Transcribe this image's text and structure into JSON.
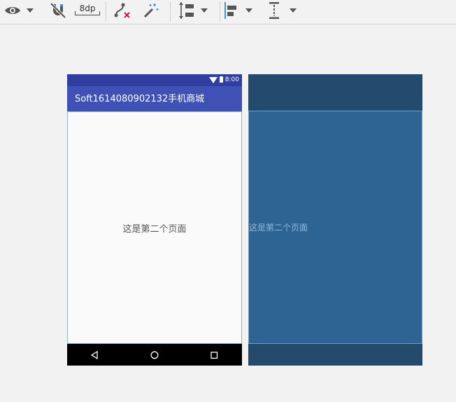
{
  "toolbar": {
    "items": [
      {
        "name": "view-options",
        "icon": "eye-icon"
      },
      {
        "name": "autoconnect",
        "icon": "magnet-off-icon"
      },
      {
        "name": "default-margin",
        "value": "8dp"
      },
      {
        "name": "clear-constraints",
        "icon": "clear-constraints-icon"
      },
      {
        "name": "infer-constraints",
        "icon": "magic-wand-icon"
      },
      {
        "name": "pack",
        "icon": "pack-icon"
      },
      {
        "name": "align",
        "icon": "align-left-icon"
      },
      {
        "name": "guidelines",
        "icon": "guideline-icon"
      }
    ],
    "margin_value": "8dp",
    "accent_color": "#4a8fd0",
    "remove_color": "#c2185b"
  },
  "device": {
    "status_time": "8:00",
    "app_title": "Soft1614080902132手机商城",
    "content_text": "这是第二个页面",
    "statusbar_color": "#303f9f",
    "appbar_color": "#3f51b5",
    "nav_buttons": [
      "back-icon",
      "home-icon",
      "recents-icon"
    ]
  },
  "blueprint": {
    "content_text": "这是第二个页面",
    "background_color": "#234b6e",
    "content_color": "#2e6494"
  }
}
